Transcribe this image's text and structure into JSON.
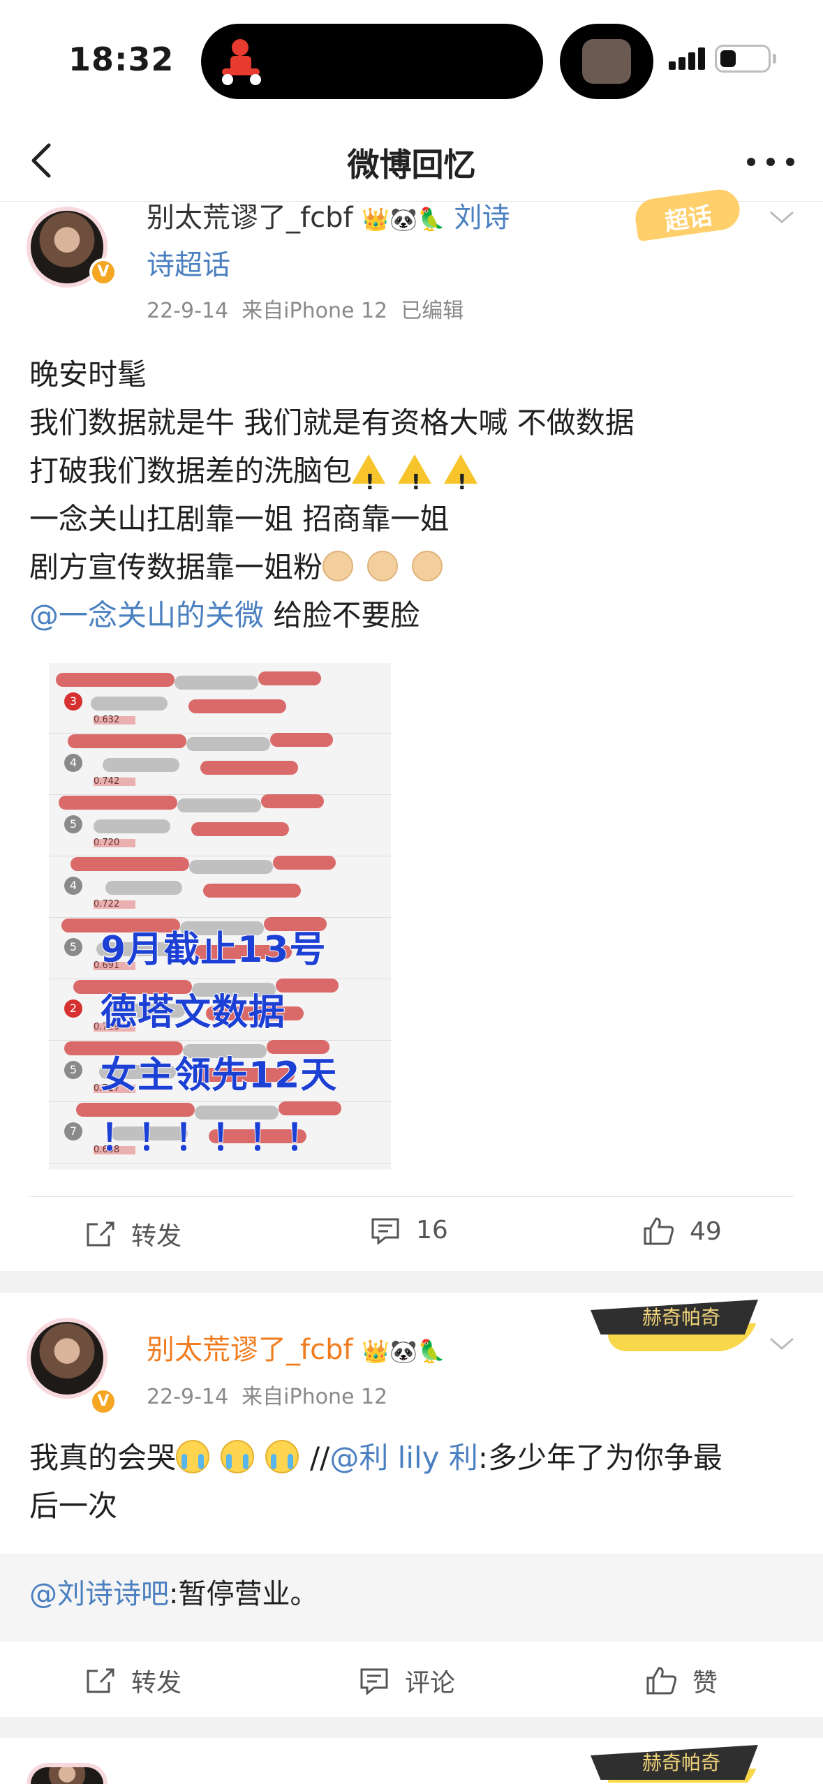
{
  "status_bar": {
    "time": "18:32"
  },
  "nav": {
    "title": "微博回忆"
  },
  "post1": {
    "username": "别太荒谬了_fcbf",
    "topic_line1": "刘诗",
    "topic_line2": "诗超话",
    "supertopic_badge": "超话",
    "meta": "22-9-14  来自iPhone 12  已编辑",
    "lines": [
      "晚安时髦",
      "我们数据就是牛  我们就是有资格大喊 不做数据",
      "打破我们数据差的洗脑包",
      "一念关山扛剧靠一姐  招商靠一姐",
      "剧方宣传数据靠一姐粉"
    ],
    "mention": "@一念关山的关微",
    "mention_tail": " 给脸不要脸",
    "image_overlay": [
      "9月截止13号",
      "德塔文数据",
      "女主领先12天",
      "！！！！！！"
    ],
    "image_rows": [
      {
        "rank": "3",
        "score": "0.632",
        "red": true
      },
      {
        "rank": "4",
        "score": "0.742",
        "red": false
      },
      {
        "rank": "5",
        "score": "0.720",
        "red": false
      },
      {
        "rank": "4",
        "score": "0.722",
        "red": false
      },
      {
        "rank": "5",
        "score": "0.691",
        "red": false
      },
      {
        "rank": "2",
        "score": "0.729",
        "red": true
      },
      {
        "rank": "5",
        "score": "0.717",
        "red": false
      },
      {
        "rank": "7",
        "score": "0.658",
        "red": false
      }
    ],
    "actions": {
      "repost": "转发",
      "comment_count": "16",
      "like_count": "49"
    }
  },
  "post2": {
    "username": "别太荒谬了_fcbf",
    "ribbon": "赫奇帕奇",
    "meta": "22-9-14  来自iPhone 12",
    "text_prefix": "我真的会哭",
    "text_slashes": "//",
    "mention": "@利 lily 利",
    "text_tail": ":多少年了为你争最",
    "text_line2": "后一次",
    "repost_mention": "@刘诗诗吧",
    "repost_text": ":暂停营业。",
    "actions": {
      "repost": "转发",
      "comment": "评论",
      "like": "赞"
    }
  },
  "post3": {
    "ribbon": "赫奇帕奇"
  }
}
